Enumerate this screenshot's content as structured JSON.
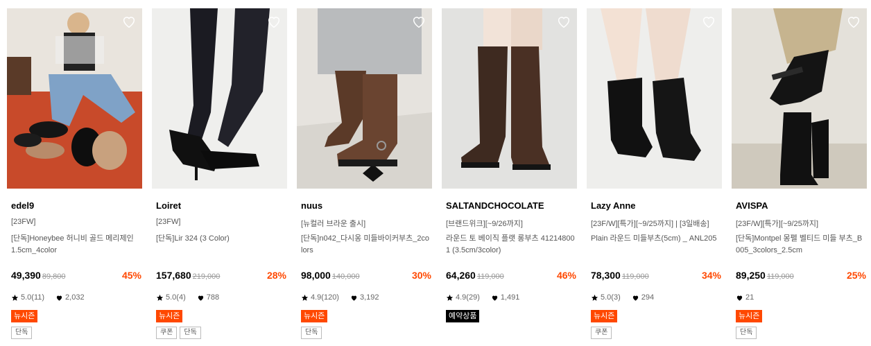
{
  "colors": {
    "accent": "#ff4800",
    "reserve_badge": "#000000"
  },
  "icons": {
    "wish": "heart-outline-icon",
    "rating": "star-icon",
    "likes": "heart-icon"
  },
  "products": [
    {
      "brand": "edel9",
      "subtitle": "[23FW]",
      "name": "[단독]Honeybee 허니비 골드 메리제인 1.5cm_4color",
      "price": "49,390",
      "original_price": "89,800",
      "discount": "45%",
      "rating": "5.0(11)",
      "likes": "2,032",
      "badge": "뉴시즌",
      "tags": [
        "단독"
      ]
    },
    {
      "brand": "Loiret",
      "subtitle": "[23FW]",
      "name": "[단독]Lir 324 (3 Color)",
      "price": "157,680",
      "original_price": "219,000",
      "discount": "28%",
      "rating": "5.0(4)",
      "likes": "788",
      "badge": "뉴시즌",
      "tags": [
        "쿠폰",
        "단독"
      ]
    },
    {
      "brand": "nuus",
      "subtitle": "[뉴컬러 브라운 출시]",
      "name": "[단독]n042_다시옹 미들바이커부츠_2colors",
      "price": "98,000",
      "original_price": "140,000",
      "discount": "30%",
      "rating": "4.9(120)",
      "likes": "3,192",
      "badge": "뉴시즌",
      "tags": [
        "단독"
      ]
    },
    {
      "brand": "SALTANDCHOCOLATE",
      "subtitle": "[브랜드위크][~9/26까지]",
      "name": "라운드 토 베이직 플랫 롱부츠 412148001 (3.5cm/3color)",
      "price": "64,260",
      "original_price": "119,000",
      "discount": "46%",
      "rating": "4.9(29)",
      "likes": "1,491",
      "badge": "예약상품",
      "tags": []
    },
    {
      "brand": "Lazy Anne",
      "subtitle": "[23F/W][특가][~9/25까지] | [3일배송]",
      "name": "Plain 라운드 미들부츠(5cm) _ ANL205",
      "price": "78,300",
      "original_price": "119,000",
      "discount": "34%",
      "rating": "5.0(3)",
      "likes": "294",
      "badge": "뉴시즌",
      "tags": [
        "쿠폰"
      ]
    },
    {
      "brand": "AVISPA",
      "subtitle": "[23F/W][특가][~9/25까지]",
      "name": "[단독]Montpel 몽펠 벨티드 미들 부츠_B005_3colors_2.5cm",
      "price": "89,250",
      "original_price": "119,000",
      "discount": "25%",
      "rating": "",
      "likes": "21",
      "badge": "뉴시즌",
      "tags": [
        "단독"
      ]
    }
  ]
}
